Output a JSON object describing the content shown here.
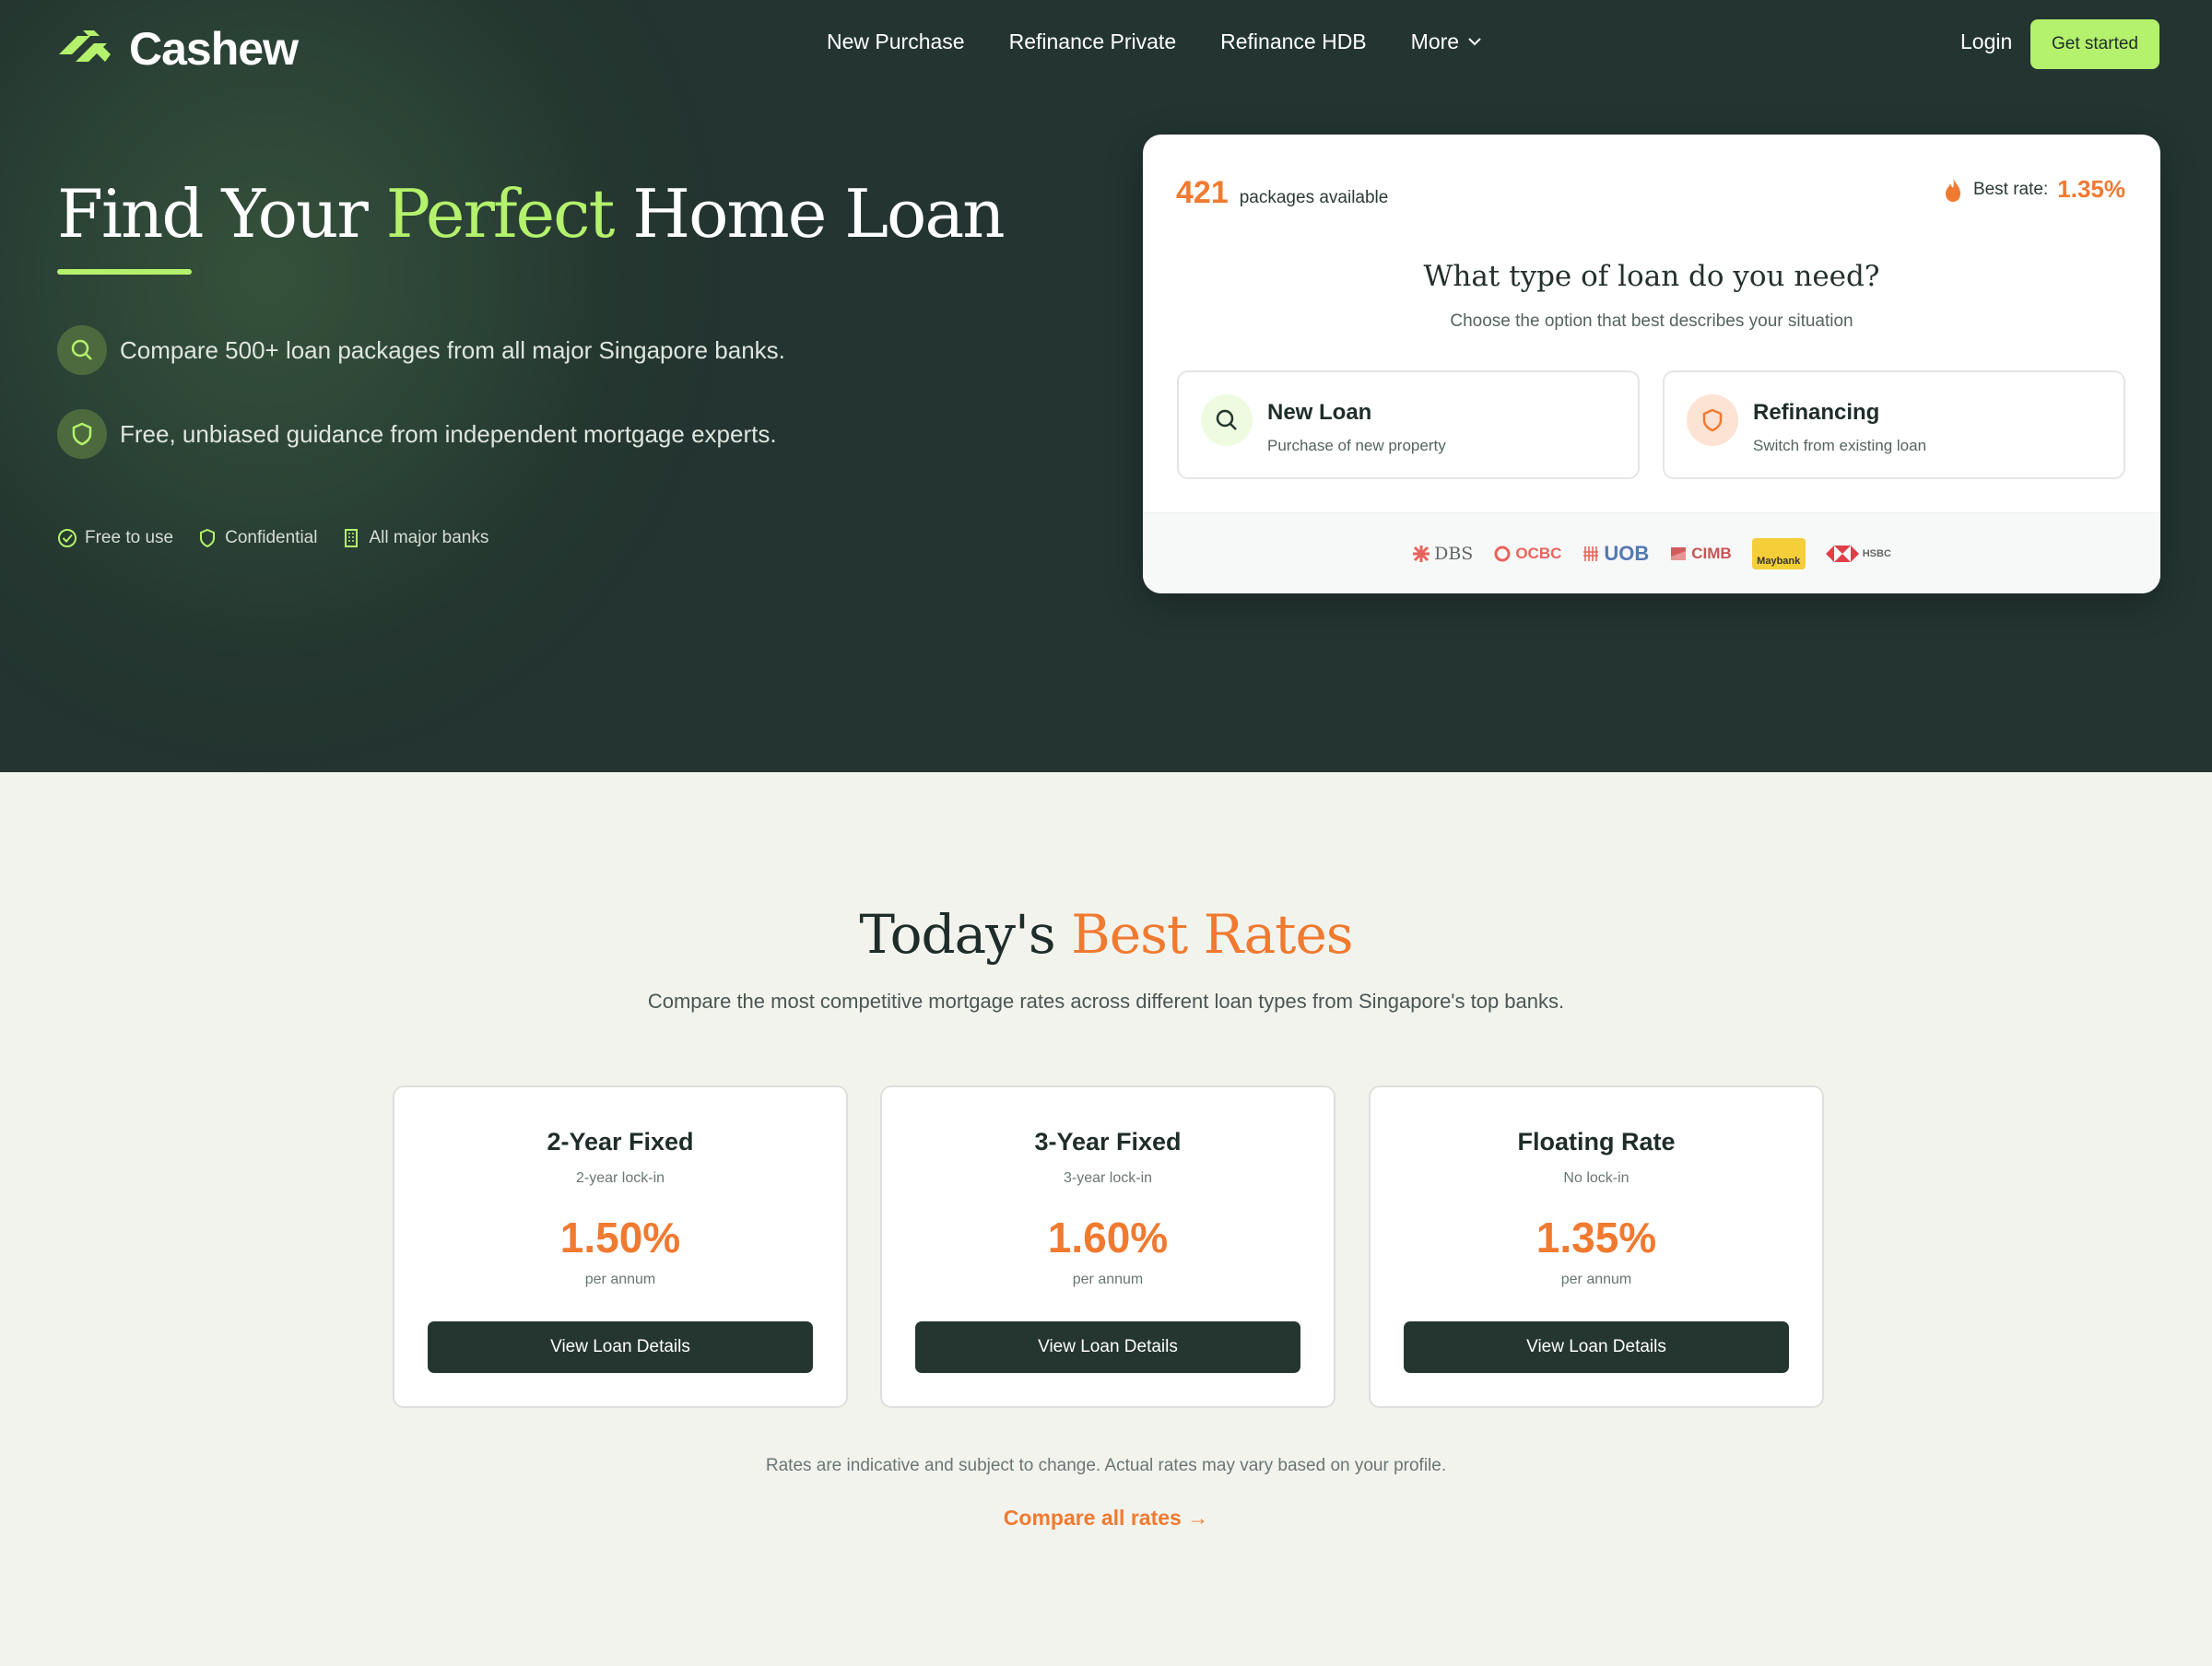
{
  "brand": {
    "name": "Cashew",
    "accent": "#b4f16c",
    "orange": "#f07a30",
    "dark": "#24362f"
  },
  "nav": {
    "links": [
      "New Purchase",
      "Refinance Private",
      "Refinance HDB",
      "More"
    ],
    "login": "Login",
    "cta": "Get started"
  },
  "hero": {
    "title_pre": "Find Your",
    "title_accent": "Perfect",
    "title_post": "Home Loan",
    "features": [
      {
        "icon": "search-icon",
        "text": "Compare 500+ loan packages from all major Singapore banks."
      },
      {
        "icon": "shield-icon",
        "text": "Free, unbiased guidance from independent mortgage experts."
      }
    ],
    "trust": [
      {
        "icon": "check-circle-icon",
        "text": "Free to use"
      },
      {
        "icon": "shield-icon",
        "text": "Confidential"
      },
      {
        "icon": "building-icon",
        "text": "All major banks"
      }
    ]
  },
  "card": {
    "count": "421",
    "count_label": "packages available",
    "best_label": "Best rate:",
    "best_value": "1.35%",
    "question": "What type of loan do you need?",
    "subtitle": "Choose the option that best describes your situation",
    "options": [
      {
        "title": "New Loan",
        "desc": "Purchase of new property",
        "icon": "search-icon"
      },
      {
        "title": "Refinancing",
        "desc": "Switch from existing loan",
        "icon": "shield-icon"
      }
    ],
    "banks": [
      "DBS",
      "OCBC",
      "UOB",
      "CIMB",
      "Maybank",
      "HSBC"
    ]
  },
  "rates": {
    "title_pre": "Today's",
    "title_accent": "Best Rates",
    "subtitle": "Compare the most competitive mortgage rates across different loan types from Singapore's top banks.",
    "cards": [
      {
        "title": "2-Year Fixed",
        "lock": "2-year lock-in",
        "rate": "1.50%",
        "unit": "per annum",
        "button": "View Loan Details"
      },
      {
        "title": "3-Year Fixed",
        "lock": "3-year lock-in",
        "rate": "1.60%",
        "unit": "per annum",
        "button": "View Loan Details"
      },
      {
        "title": "Floating Rate",
        "lock": "No lock-in",
        "rate": "1.35%",
        "unit": "per annum",
        "button": "View Loan Details"
      }
    ],
    "disclaimer": "Rates are indicative and subject to change. Actual rates may vary based on your profile.",
    "compare_link": "Compare all rates →"
  }
}
